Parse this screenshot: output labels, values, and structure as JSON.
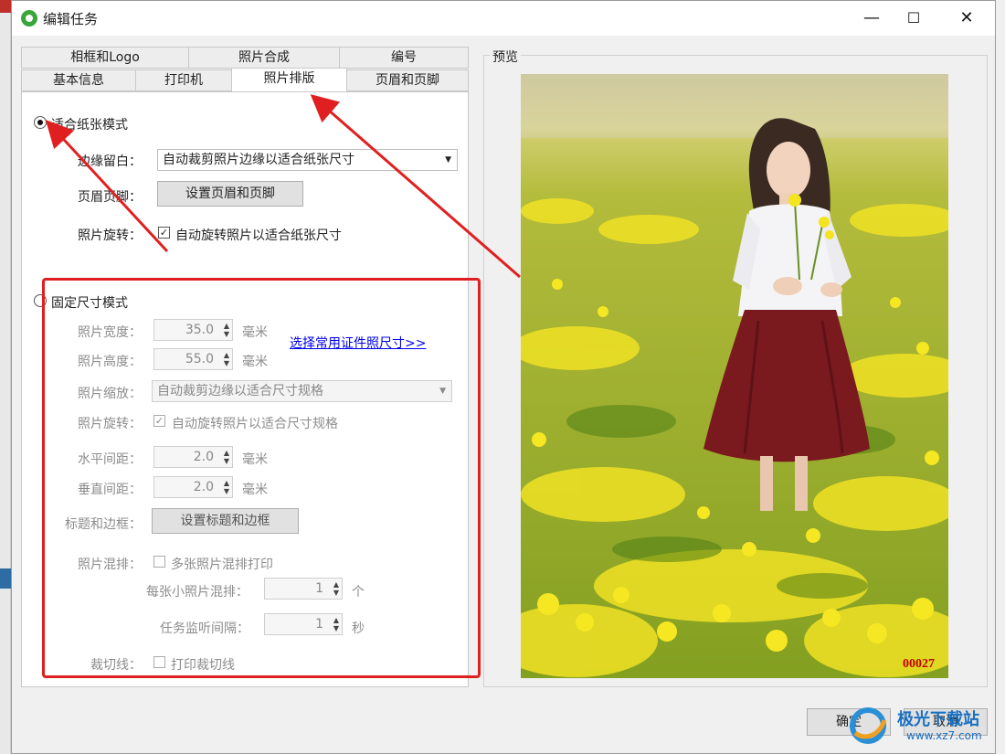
{
  "window": {
    "title": "编辑任务",
    "minimize": "—",
    "maximize": "☐",
    "close": "✕"
  },
  "tabs": {
    "row1": [
      "相框和Logo",
      "照片合成",
      "编号"
    ],
    "row2": [
      "基本信息",
      "打印机",
      "照片排版",
      "页眉和页脚"
    ],
    "selected": "照片排版"
  },
  "fit_mode": {
    "label": "适合纸张模式",
    "selected": true,
    "margin_label": "边缘留白：",
    "margin_value": "自动裁剪照片边缘以适合纸张尺寸",
    "header_label": "页眉页脚：",
    "header_button": "设置页眉和页脚",
    "rotate_label": "照片旋转：",
    "rotate_check": "自动旋转照片以适合纸张尺寸",
    "rotate_checked": true
  },
  "fixed_mode": {
    "label": "固定尺寸模式",
    "selected": false,
    "width_label": "照片宽度：",
    "width_value": "35.0",
    "height_label": "照片高度：",
    "height_value": "55.0",
    "unit": "毫米",
    "preset_link": "选择常用证件照尺寸>>",
    "scale_label": "照片缩放：",
    "scale_value": "自动裁剪边缘以适合尺寸规格",
    "rotate_label": "照片旋转：",
    "rotate_check": "自动旋转照片以适合尺寸规格",
    "rotate_checked": true,
    "hspace_label": "水平间距：",
    "hspace_value": "2.0",
    "vspace_label": "垂直间距：",
    "vspace_value": "2.0",
    "title_border_label": "标题和边框：",
    "title_border_button": "设置标题和边框",
    "mix_label": "照片混排：",
    "mix_check": "多张照片混排打印",
    "mix_checked": false,
    "per_sheet_label": "每张小照片混排：",
    "per_sheet_value": "1",
    "per_sheet_unit": "个",
    "interval_label": "任务监听间隔：",
    "interval_value": "1",
    "interval_unit": "秒",
    "cutline_label": "裁切线：",
    "cutline_check": "打印裁切线",
    "cutline_checked": false
  },
  "preview": {
    "label": "预览",
    "photo_number": "00027"
  },
  "buttons": {
    "ok": "确定",
    "cancel": "取消"
  },
  "watermark": {
    "text": "极光下载站",
    "url": "www.xz7.com"
  },
  "colors": {
    "accent_red": "#e02020",
    "link": "#0000ee",
    "photo_number": "#c00000"
  }
}
